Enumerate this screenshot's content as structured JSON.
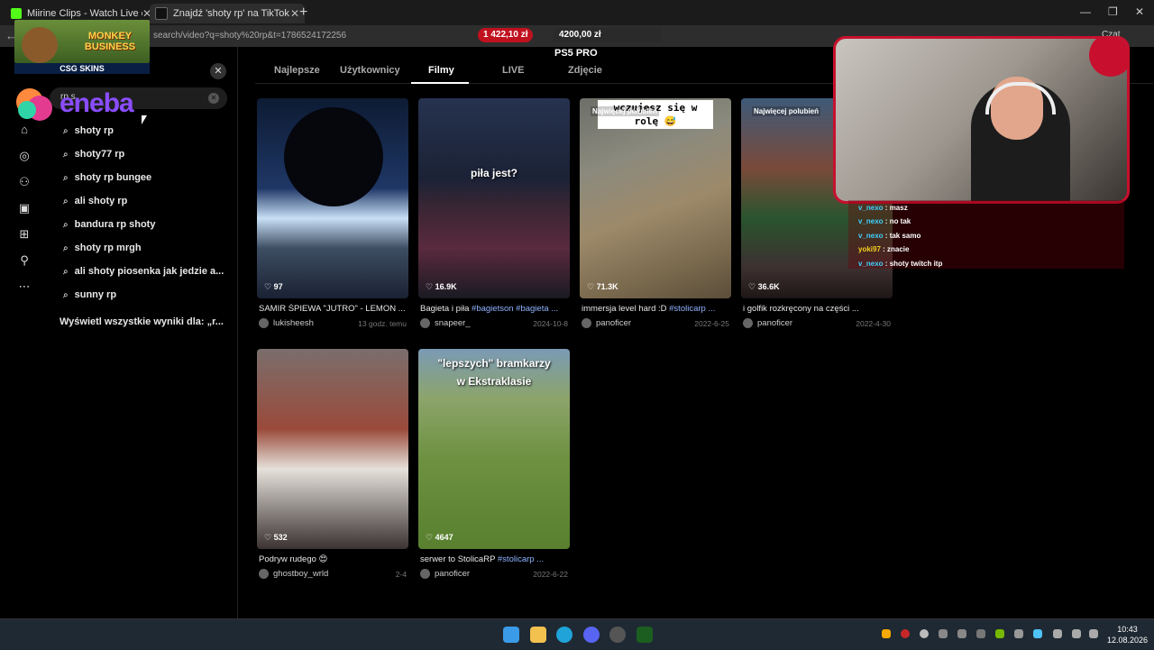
{
  "browser": {
    "tabs": [
      {
        "title": "Miirine Clips - Watch Live on Kick",
        "color": "#53fc18"
      },
      {
        "title": "Znajdź 'shoty rp' na TikTok | Wysz",
        "color": "#ffffff"
      }
    ],
    "url": "search/video?q=shoty%20rp&t=1786524172256",
    "profile_label": "Czat",
    "donations": {
      "amount1": "1 422,10 zł",
      "amount2": "4200,00 zł",
      "amount3": ""
    }
  },
  "overlays": {
    "monkey_title": "MONKEY BUSINESS",
    "csg_label": "CSG SKINS",
    "eneba_label": "eneba"
  },
  "search": {
    "value": "rp s",
    "suggestions": [
      "shoty rp",
      "shoty77 rp",
      "shoty rp bungee",
      "ali shoty rp",
      "bandura rp shoty",
      "shoty rp mrgh",
      "ali shoty piosenka jak jedzie a...",
      "sunny rp"
    ],
    "show_all": "Wyświetl wszystkie wyniki dla: „r..."
  },
  "header": {
    "title": "PS5 PRO"
  },
  "filter_tabs": [
    "Najlepsze",
    "Użytkownicy",
    "Filmy",
    "LIVE",
    "Zdjęcie"
  ],
  "active_tab": "Filmy",
  "videos": [
    {
      "likes": "97",
      "desc": "SAMIR ŚPIEWA \"JUTRO\" - LEMON ...",
      "tag": "",
      "author": "lukisheesh",
      "date": "13 godz. temu",
      "badge": "",
      "overlay": ""
    },
    {
      "likes": "16.9K",
      "desc": "Bagieta i piła ",
      "tag": "#bagietson #bagieta ...",
      "author": "snapeer_",
      "date": "2024-10-8",
      "badge": "",
      "overlay": "piła jest?"
    },
    {
      "likes": "71.3K",
      "desc": "immersja level hard :D ",
      "tag": "#stolicarp ...",
      "author": "panoficer",
      "date": "2022-6-25",
      "badge": "Najwięcej polubień",
      "overlay": "wczujesz się w rolę 😅"
    },
    {
      "likes": "36.6K",
      "desc": "i golfik rozkręcony na części ...",
      "tag": "",
      "author": "panoficer",
      "date": "2022-4-30",
      "badge": "Najwięcej polubień",
      "overlay": ""
    },
    {
      "likes": "532",
      "desc": "Podryw rudego 😍",
      "tag": "",
      "author": "ghostboy_wrld",
      "date": "2-4",
      "badge": "",
      "overlay": ""
    },
    {
      "likes": "4647",
      "desc": "serwer to StolicaRP ",
      "tag": "#stolicarp ...",
      "author": "panoficer",
      "date": "2022-6-22",
      "badge": "",
      "overlay": "\"lepszych\" bramkarzy w Ekstraklasie"
    }
  ],
  "chat": [
    {
      "user": "v_nexo",
      "msg": "masz"
    },
    {
      "user": "v_nexo",
      "msg": "no tak"
    },
    {
      "user": "v_nexo",
      "msg": "tak samo"
    },
    {
      "user": "yoki97",
      "msg": "znacie"
    },
    {
      "user": "v_nexo",
      "msg": "shoty twitch itp"
    }
  ],
  "taskbar": {
    "time": "10:43",
    "date": "12.08.2026"
  },
  "colors": {
    "accent": "#c8102e",
    "tag": "#8fb3ff",
    "chat_user": "#3fd0ff"
  }
}
